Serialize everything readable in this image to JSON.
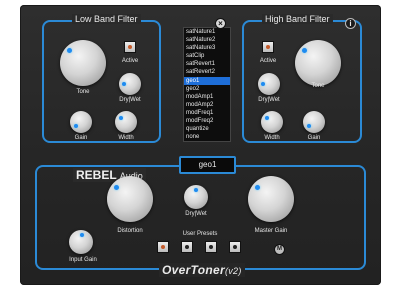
{
  "low_band_filter": {
    "title": "Low Band Filter",
    "tone_label": "Tone",
    "active_label": "Active",
    "drywet_label": "Dry|Wet",
    "gain_label": "Gain",
    "width_label": "Width"
  },
  "high_band_filter": {
    "title": "High Band Filter",
    "tone_label": "Tone",
    "active_label": "Active",
    "drywet_label": "Dry|Wet",
    "gain_label": "Gain",
    "width_label": "Width"
  },
  "preset_list": {
    "items": [
      "satNature1",
      "satNature2",
      "satNature3",
      "satClip",
      "satRevert1",
      "satRevert2",
      "geo1",
      "geo2",
      "modAmp1",
      "modAmp2",
      "modFreq1",
      "modFreq2",
      "quantize",
      "none"
    ],
    "selected": "geo1"
  },
  "icons": {
    "close": "close-icon",
    "info": "info-icon"
  },
  "main": {
    "brand": "REBEL",
    "brand_sub": "Audio",
    "current_preset": "geo1",
    "distortion_label": "Distortion",
    "drywet_label": "Dry|Wet",
    "master_gain_label": "Master Gain",
    "input_gain_label": "Input Gain",
    "user_presets_label": "User Presets",
    "product_name": "OverToner",
    "product_version": "(v2)",
    "logo_letter": "M"
  },
  "colors": {
    "accent": "#2b8ad6",
    "background": "#2a2a2a",
    "selected": "#1e6ed8",
    "led_active": "#c45a2a"
  }
}
